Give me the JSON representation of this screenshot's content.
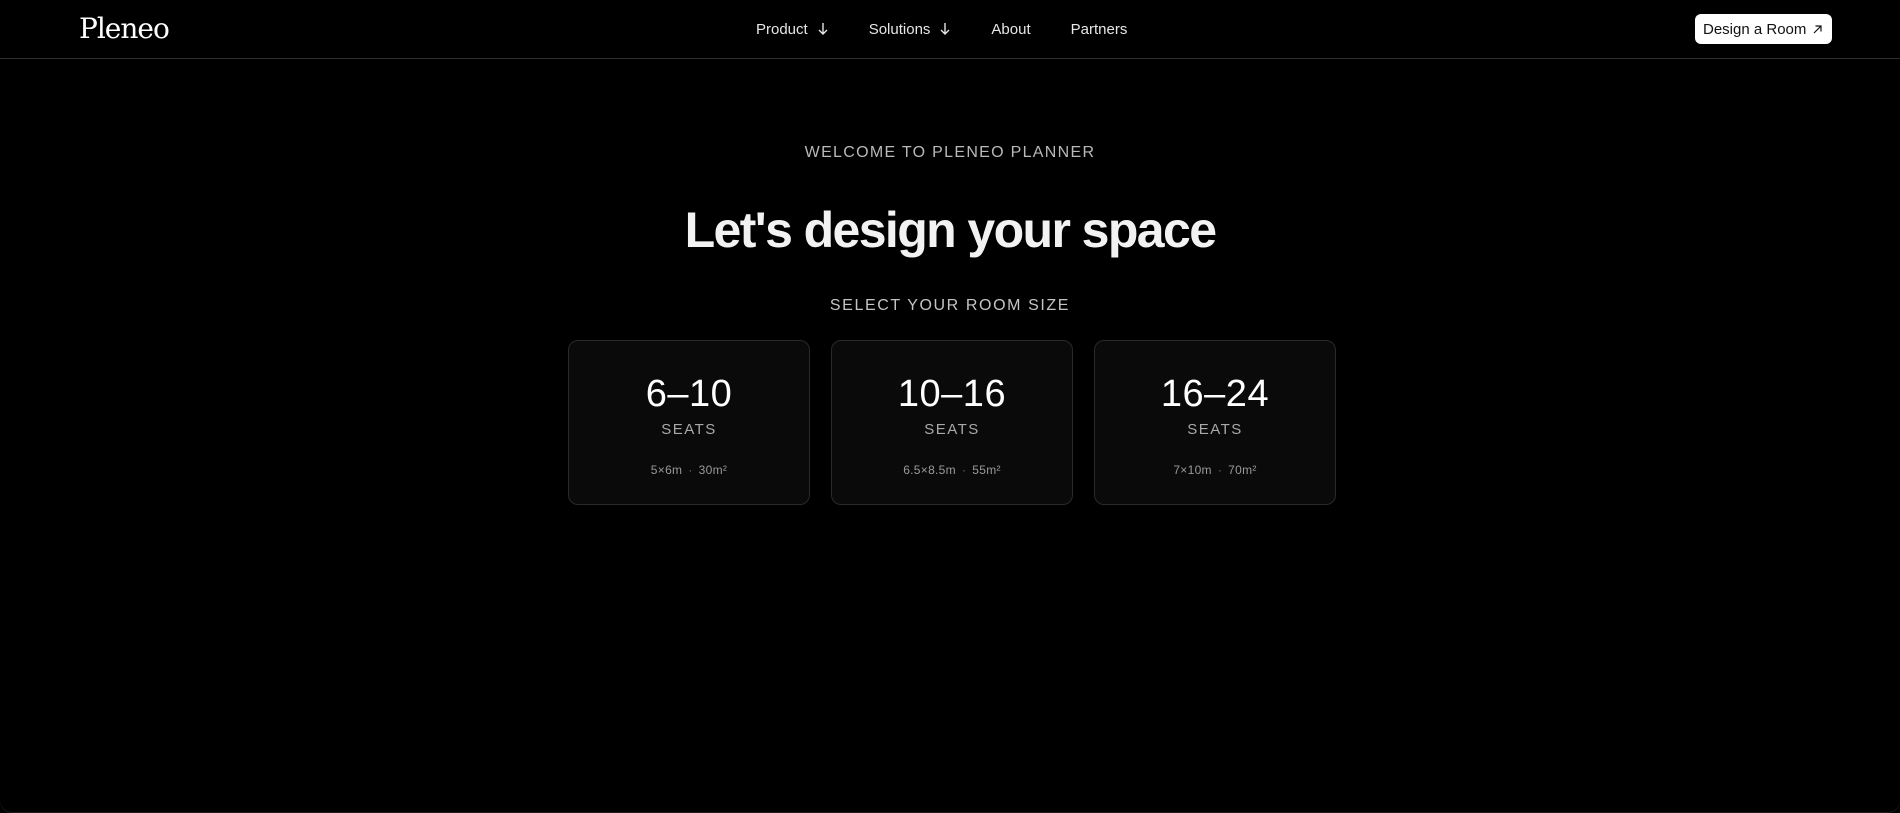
{
  "header": {
    "logo": "Pleneo",
    "nav": [
      {
        "label": "Product",
        "has_dropdown": true
      },
      {
        "label": "Solutions",
        "has_dropdown": true
      },
      {
        "label": "About",
        "has_dropdown": false
      },
      {
        "label": "Partners",
        "has_dropdown": false
      }
    ],
    "cta_label": "Design a Room"
  },
  "hero": {
    "eyebrow": "WELCOME TO PLENEO PLANNER",
    "headline": "Let's design your space",
    "select_label": "SELECT YOUR ROOM SIZE"
  },
  "rooms": [
    {
      "range": "6–10",
      "unit": "SEATS",
      "dims": "5×6m",
      "area": "30m²"
    },
    {
      "range": "10–16",
      "unit": "SEATS",
      "dims": "6.5×8.5m",
      "area": "55m²"
    },
    {
      "range": "16–24",
      "unit": "SEATS",
      "dims": "7×10m",
      "area": "70m²"
    }
  ],
  "colors": {
    "background": "#000000",
    "card_background": "#0a0a0a",
    "card_border": "#2a2a2a",
    "cta_background": "#ffffff"
  },
  "icons": {
    "dropdown": "arrow-down-icon",
    "cta": "arrow-up-right-icon"
  }
}
